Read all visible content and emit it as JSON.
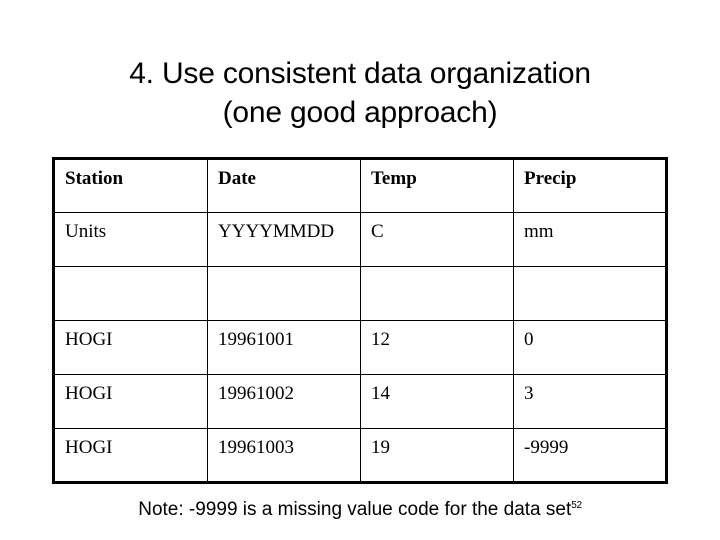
{
  "slide": {
    "title_lines": [
      "4. Use consistent data organization",
      "(one good approach)"
    ],
    "background_color": "#ffffff",
    "text_color": "#000000",
    "slide_number": "52"
  },
  "table": {
    "border_color": "#000000",
    "columns": [
      "Station",
      "Date",
      "Temp",
      "Precip"
    ],
    "rows": [
      {
        "type": "units",
        "cells": [
          "Units",
          "YYYYMMDD",
          "C",
          "mm"
        ]
      },
      {
        "type": "blank",
        "cells": [
          "",
          "",
          "",
          ""
        ]
      },
      {
        "type": "data",
        "cells": [
          "HOGI",
          "19961001",
          "12",
          "0"
        ]
      },
      {
        "type": "data",
        "cells": [
          "HOGI",
          "19961002",
          "14",
          "3"
        ]
      },
      {
        "type": "data",
        "cells": [
          "HOGI",
          "19961003",
          "19",
          "-9999"
        ]
      }
    ]
  },
  "footer": {
    "note": "Note: -9999 is a missing value code for the data set"
  }
}
